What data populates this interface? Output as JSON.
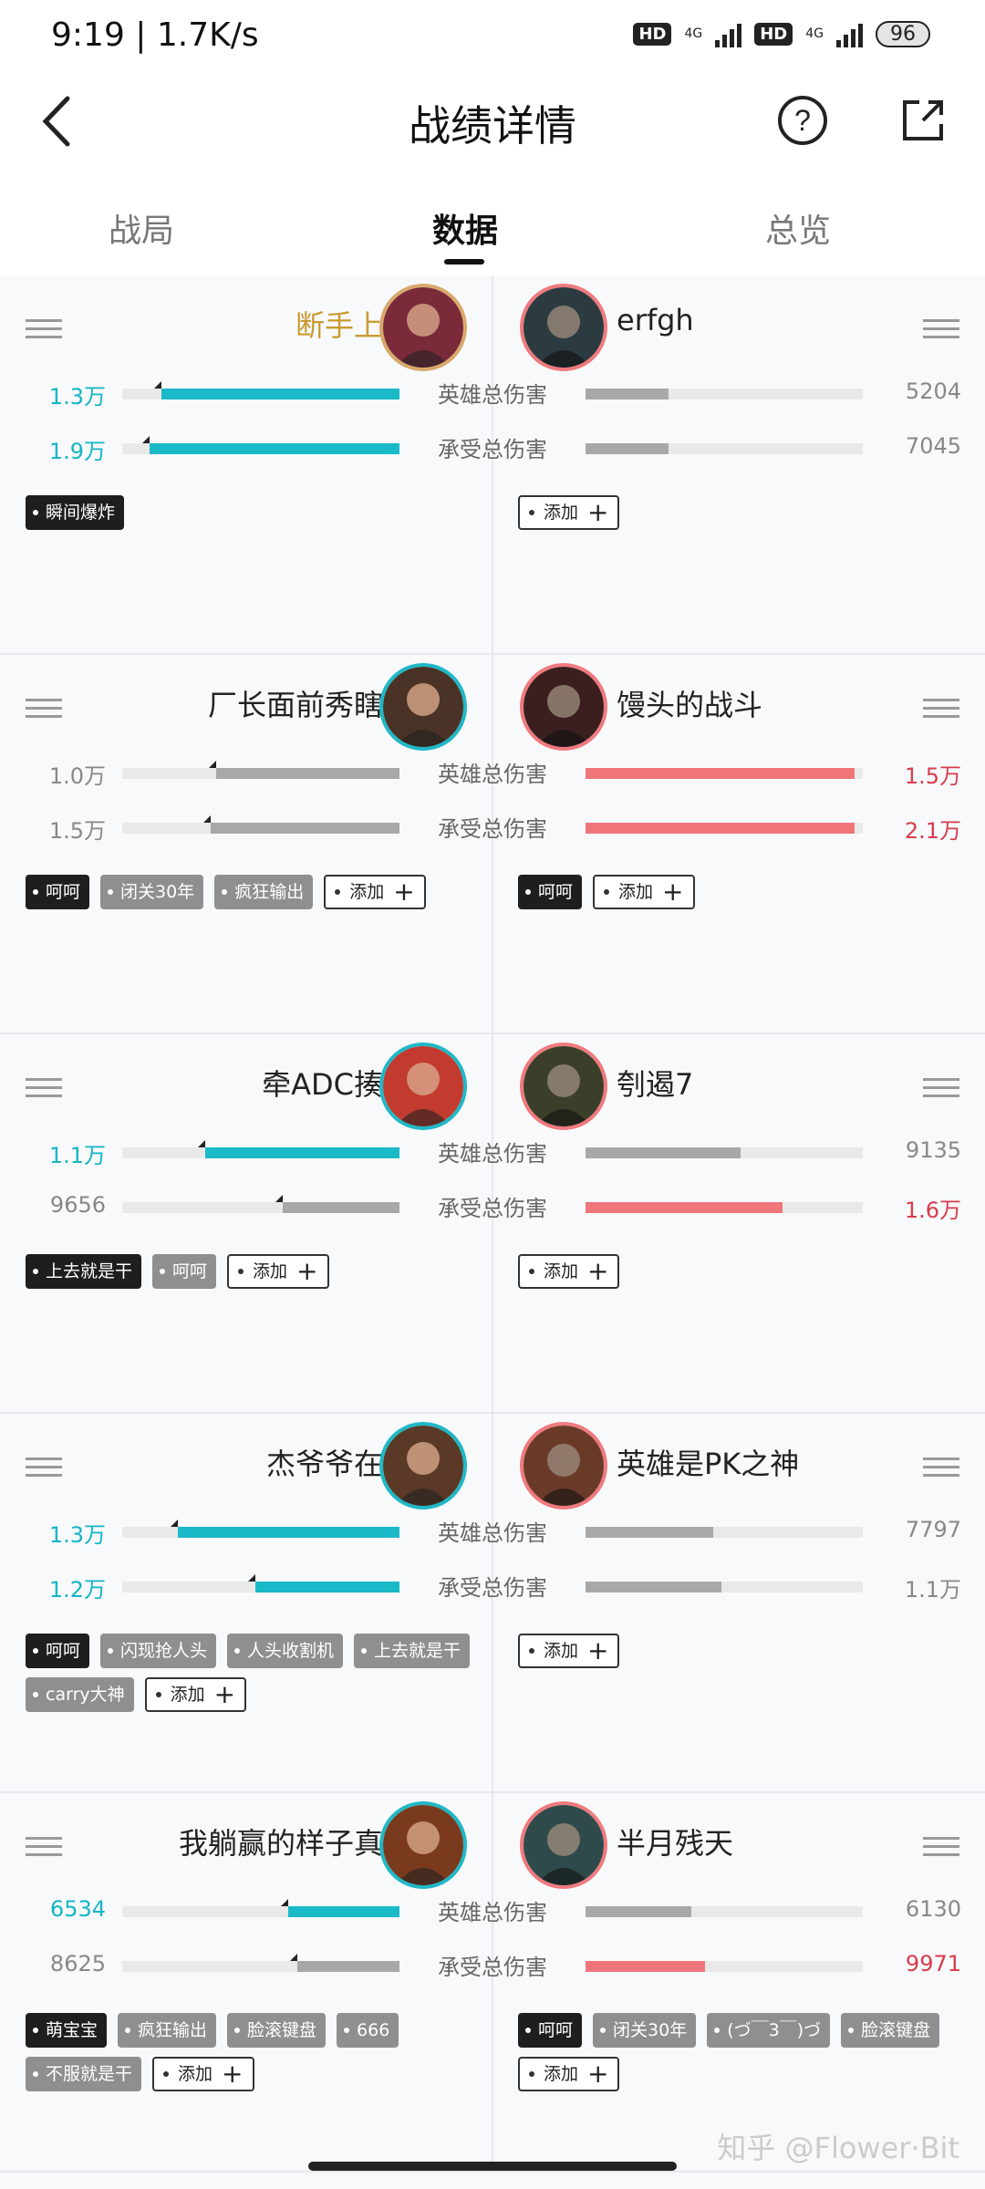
{
  "status_bar": {
    "time": "9:19 | 1.7K/s",
    "hd1": "HD",
    "net1": "4G",
    "hd2": "HD",
    "net2": "4G",
    "battery": "96"
  },
  "header": {
    "title": "战绩详情",
    "back_icon": "chevron-left-icon",
    "help_icon": "question-circle-icon",
    "share_icon": "share-icon"
  },
  "tabs": [
    {
      "label": "战局"
    },
    {
      "label": "数据"
    },
    {
      "label": "总览"
    }
  ],
  "active_tab": 1,
  "labels": {
    "damage_dealt": "英雄总伤害",
    "damage_taken": "承受总伤害",
    "add": "添加"
  },
  "colors": {
    "cyan": "#1ab9c7",
    "red": "#f0757a",
    "gray": "#a8a8a8",
    "gold_name": "#c99b2f"
  },
  "matchups": [
    {
      "left": {
        "name": "断手上单",
        "dealt": "1.3万",
        "taken": "1.9万",
        "dealt_frac": 0.86,
        "taken_frac": 0.9,
        "dealt_color": "cyan",
        "taken_color": "cyan",
        "tags": [
          {
            "text": "瞬间爆炸",
            "style": "dark"
          }
        ]
      },
      "right": {
        "name": "erfgh",
        "dealt": "5204",
        "taken": "7045",
        "dealt_frac": 0.3,
        "taken_frac": 0.3,
        "dealt_color": "gray",
        "taken_color": "gray",
        "tags": []
      }
    },
    {
      "left": {
        "name": "厂长面前秀瞎子",
        "dealt": "1.0万",
        "taken": "1.5万",
        "dealt_frac": 0.66,
        "taken_frac": 0.68,
        "dealt_color": "gray",
        "taken_color": "gray",
        "tags": [
          {
            "text": "呵呵",
            "style": "dark"
          },
          {
            "text": "闭关30年",
            "style": "gray"
          },
          {
            "text": "疯狂输出",
            "style": "gray"
          }
        ]
      },
      "right": {
        "name": "馒头的战斗",
        "dealt": "1.5万",
        "taken": "2.1万",
        "dealt_frac": 0.97,
        "taken_frac": 0.97,
        "dealt_color": "red",
        "taken_color": "red",
        "tags": [
          {
            "text": "呵呵",
            "style": "dark"
          }
        ]
      }
    },
    {
      "left": {
        "name": "牵ADC揍你",
        "dealt": "1.1万",
        "taken": "9656",
        "dealt_frac": 0.7,
        "taken_frac": 0.42,
        "dealt_color": "cyan",
        "taken_color": "gray",
        "tags": [
          {
            "text": "上去就是干",
            "style": "dark"
          },
          {
            "text": "呵呵",
            "style": "gray"
          }
        ]
      },
      "right": {
        "name": "刳遏7",
        "dealt": "9135",
        "taken": "1.6万",
        "dealt_frac": 0.56,
        "taken_frac": 0.71,
        "dealt_color": "gray",
        "taken_color": "red",
        "tags": []
      }
    },
    {
      "left": {
        "name": "杰爷爷在此",
        "dealt": "1.3万",
        "taken": "1.2万",
        "dealt_frac": 0.8,
        "taken_frac": 0.52,
        "dealt_color": "cyan",
        "taken_color": "cyan",
        "tags": [
          {
            "text": "呵呵",
            "style": "dark"
          },
          {
            "text": "闪现抢人头",
            "style": "gray"
          },
          {
            "text": "人头收割机",
            "style": "gray"
          },
          {
            "text": "上去就是干",
            "style": "gray"
          },
          {
            "text": "carry大神",
            "style": "gray"
          }
        ]
      },
      "right": {
        "name": "英雄是PK之神",
        "dealt": "7797",
        "taken": "1.1万",
        "dealt_frac": 0.46,
        "taken_frac": 0.49,
        "dealt_color": "gray",
        "taken_color": "gray",
        "tags": []
      }
    },
    {
      "left": {
        "name": "我躺赢的样子真靓",
        "dealt": "6534",
        "taken": "8625",
        "dealt_frac": 0.4,
        "taken_frac": 0.37,
        "dealt_color": "cyan",
        "taken_color": "gray",
        "tags": [
          {
            "text": "萌宝宝",
            "style": "dark"
          },
          {
            "text": "疯狂输出",
            "style": "gray"
          },
          {
            "text": "脸滚键盘",
            "style": "gray"
          },
          {
            "text": "666",
            "style": "gray"
          },
          {
            "text": "不服就是干",
            "style": "gray"
          }
        ]
      },
      "right": {
        "name": "半月残天",
        "dealt": "6130",
        "taken": "9971",
        "dealt_frac": 0.38,
        "taken_frac": 0.43,
        "dealt_color": "gray",
        "taken_color": "red",
        "tags": [
          {
            "text": "呵呵",
            "style": "dark"
          },
          {
            "text": "闭关30年",
            "style": "gray"
          },
          {
            "text": "(づ￣3￣)づ",
            "style": "gray"
          },
          {
            "text": "脸滚键盘",
            "style": "gray"
          }
        ]
      }
    }
  ],
  "watermark": "知乎 @Flower·Bit"
}
